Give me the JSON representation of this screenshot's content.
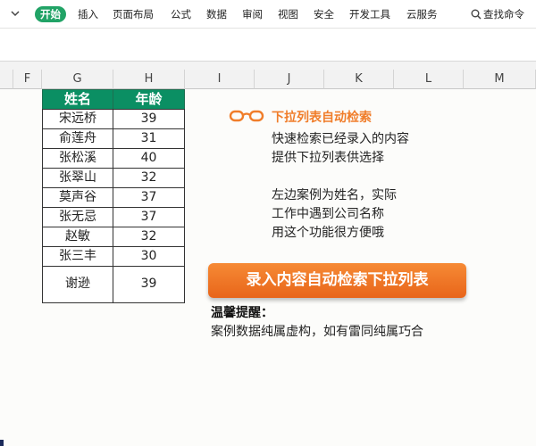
{
  "menu": {
    "items": [
      "开始",
      "插入",
      "页面布局",
      "公式",
      "数据",
      "审阅",
      "视图",
      "安全",
      "开发工具",
      "云服务"
    ],
    "active_index": 0,
    "search_label": "查找命令"
  },
  "columns": [
    "F",
    "G",
    "H",
    "I",
    "J",
    "K",
    "L",
    "M"
  ],
  "table": {
    "headers": [
      "姓名",
      "年龄"
    ],
    "rows": [
      [
        "宋远桥",
        "39"
      ],
      [
        "俞莲舟",
        "31"
      ],
      [
        "张松溪",
        "40"
      ],
      [
        "张翠山",
        "32"
      ],
      [
        "莫声谷",
        "37"
      ],
      [
        "张无忌",
        "37"
      ],
      [
        "赵敏",
        "32"
      ],
      [
        "张三丰",
        "30"
      ],
      [
        "谢逊",
        "39"
      ]
    ],
    "header_color": "#0b8f63"
  },
  "info": {
    "title": "下拉列表自动检索",
    "lines": [
      "快速检索已经录入的内容",
      "提供下拉列表供选择",
      "",
      "左边案例为姓名，实际",
      "工作中遇到公司名称",
      "用这个功能很方便哦"
    ],
    "title_color": "#f07d2a"
  },
  "cta": {
    "label": "录入内容自动检索下拉列表",
    "color": "#ee7426"
  },
  "tip": {
    "title": "温馨提醒：",
    "text": "案例数据纯属虚构，如有雷同纯属巧合"
  }
}
